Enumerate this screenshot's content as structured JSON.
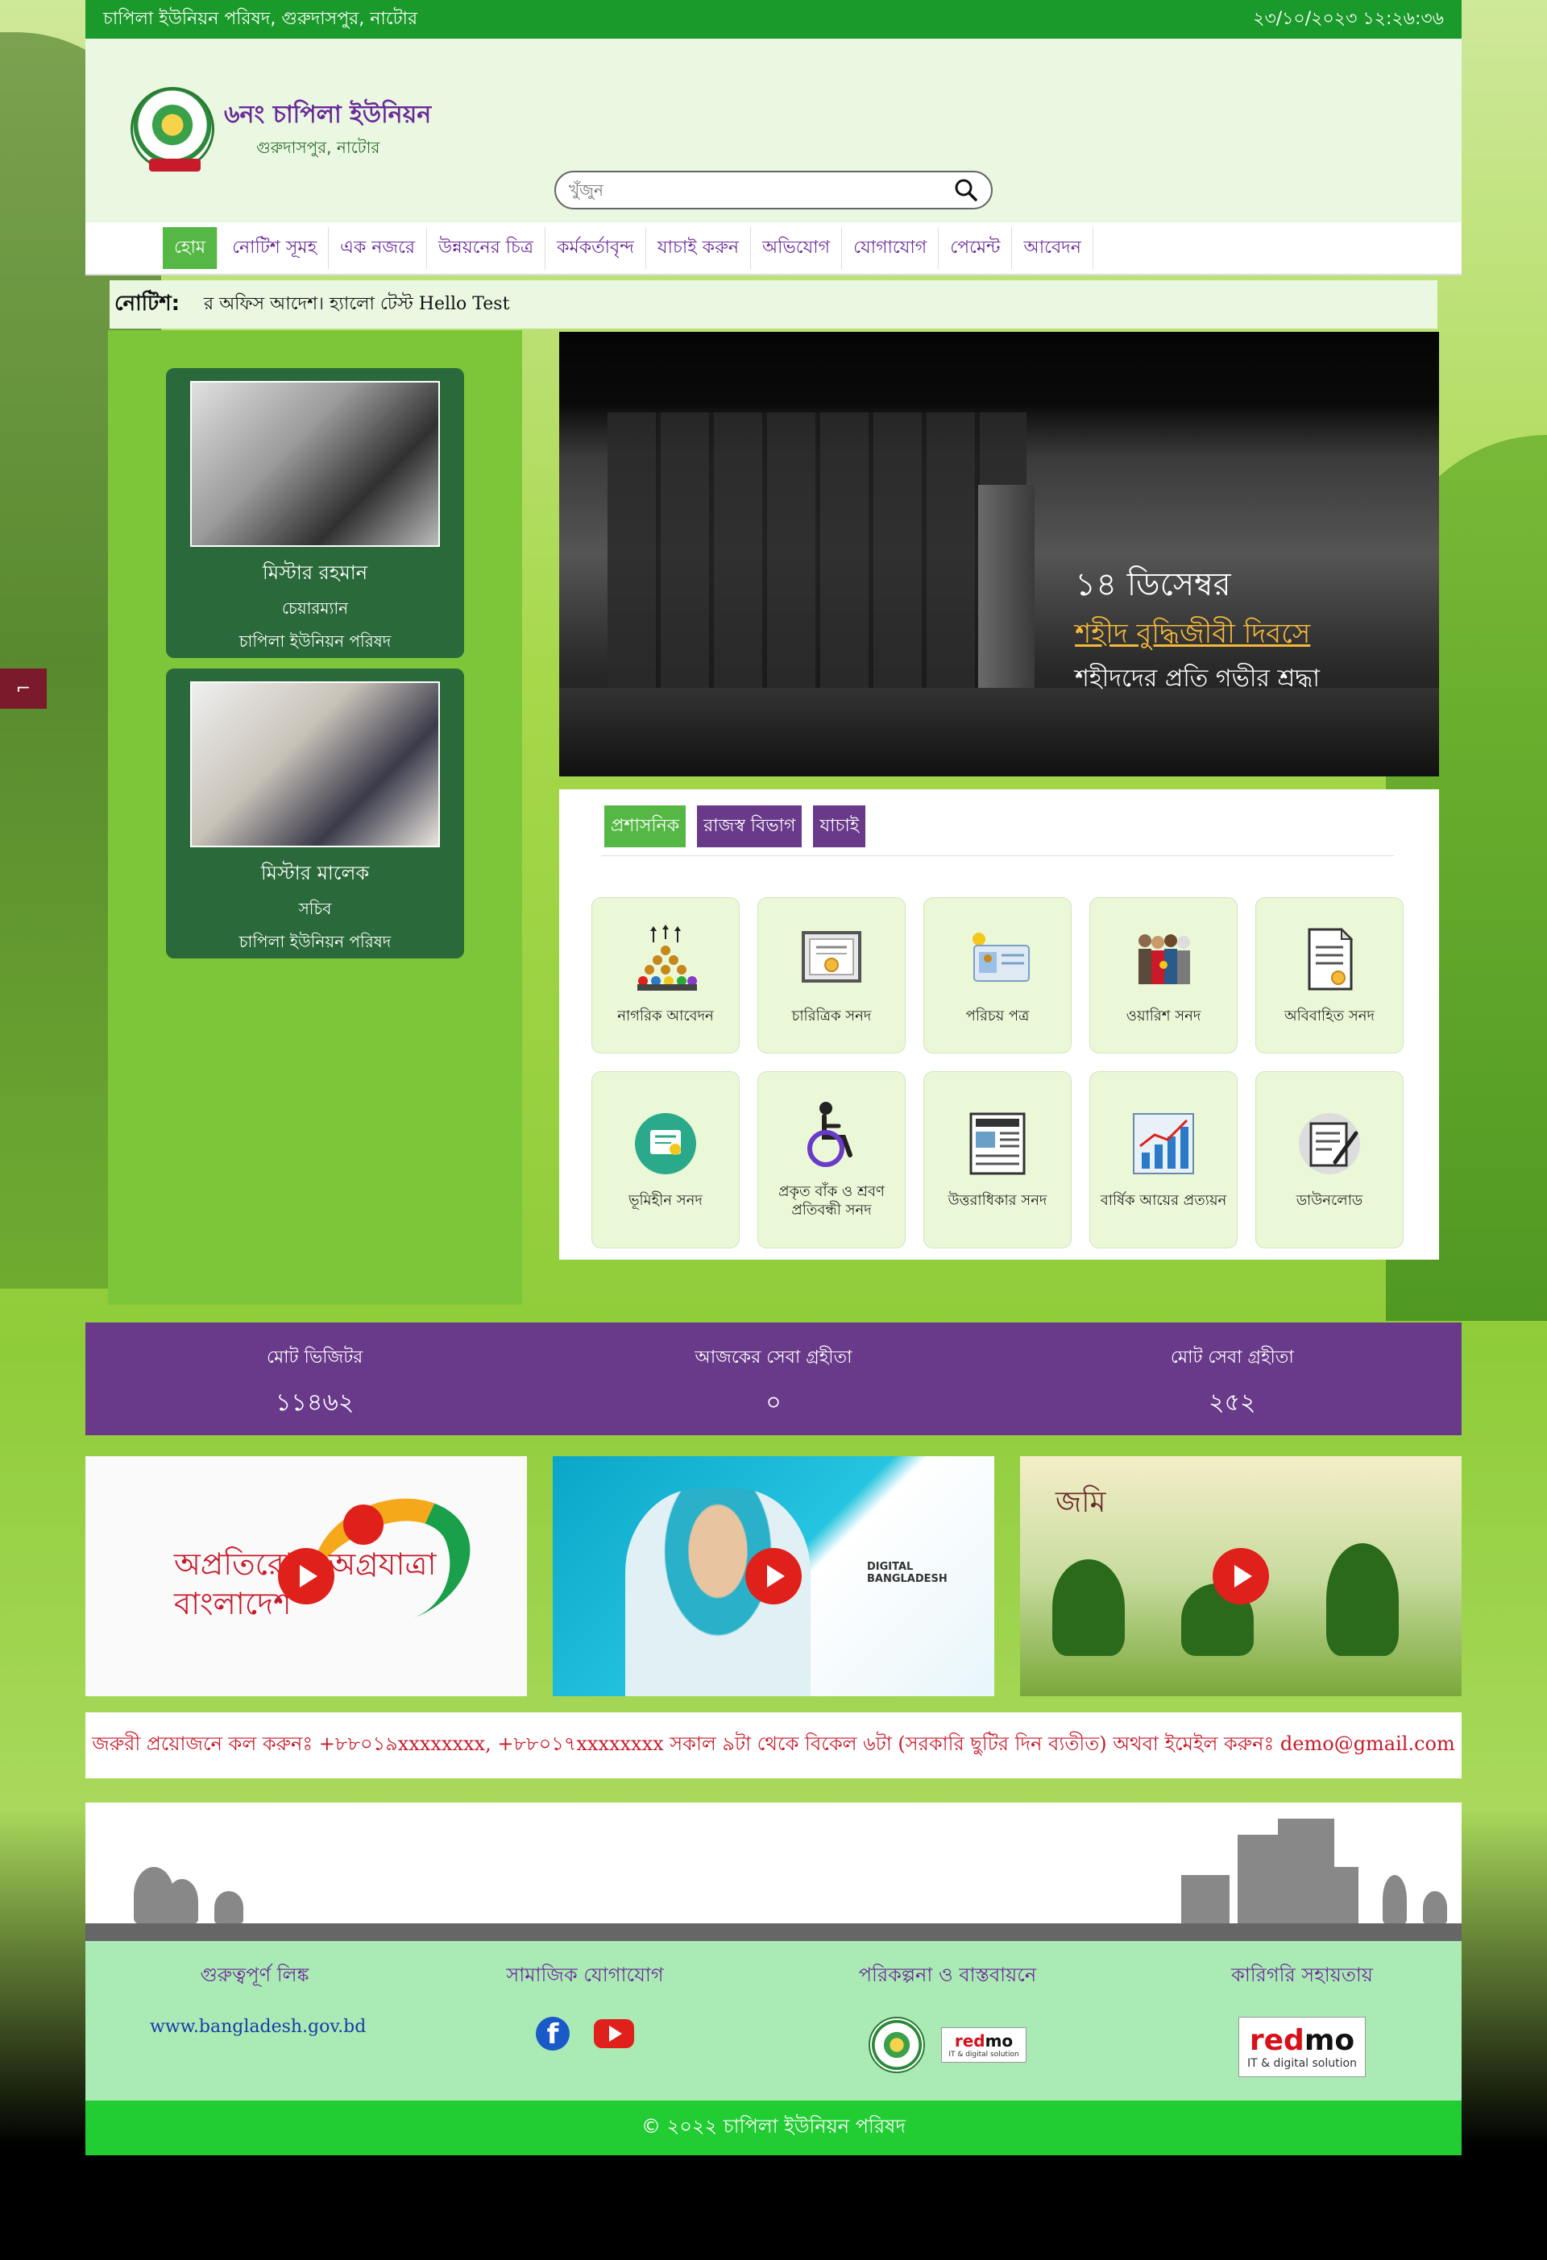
{
  "topbar": {
    "left_text": "চাপিলা ইউনিয়ন পরিষদ, গুরুদাসপুর, নাটোর",
    "datetime": "২৩/১০/২০২৩ ১২:২৬:৩৬"
  },
  "header": {
    "title": "৬নং চাপিলা ইউনিয়ন",
    "subtitle": "গুরুদাসপুর, নাটোর"
  },
  "search": {
    "placeholder": "খুঁজুন"
  },
  "nav": {
    "items": [
      "হোম",
      "নোটিশ সূমহ",
      "এক নজরে",
      "উন্নয়নের চিত্র",
      "কর্মকর্তাবৃন্দ",
      "যাচাই করুন",
      "অভিযোগ",
      "যোগাযোগ",
      "পেমেন্ট",
      "আবেদন"
    ]
  },
  "notice": {
    "label": "নোটিশ:",
    "text": "র অফিস আদেশ। হ্যালো টেস্ট Hello Test"
  },
  "officials": [
    {
      "name": "মিস্টার রহমান",
      "role": "চেয়ারম্যান",
      "org": "চাপিলা ইউনিয়ন পরিষদ"
    },
    {
      "name": "মিস্টার মালেক",
      "role": "সচিব",
      "org": "চাপিলা ইউনিয়ন পরিষদ"
    }
  ],
  "banner": {
    "line1": "১৪ ডিসেম্বর",
    "line2": "শহীদ বুদ্ধিজীবী দিবসে",
    "line3": "শহীদদের প্রতি গভীর শ্রদ্ধা"
  },
  "service_tabs": [
    "প্রশাসনিক",
    "রাজস্ব বিভাগ",
    "যাচাই"
  ],
  "services": [
    {
      "label": "নাগরিক আবেদন",
      "icon": "citizens-icon"
    },
    {
      "label": "চারিত্রিক সনদ",
      "icon": "certificate-icon"
    },
    {
      "label": "পরিচয় পত্র",
      "icon": "id-card-icon"
    },
    {
      "label": "ওয়ারিশ সনদ",
      "icon": "family-icon"
    },
    {
      "label": "অবিবাহিত সনদ",
      "icon": "document-seal-icon"
    },
    {
      "label": "ভূমিহীন সনদ",
      "icon": "award-icon"
    },
    {
      "label": "প্রকৃত বাঁক ও শ্রবণ প্রতিবন্ধী সনদ",
      "icon": "wheelchair-icon"
    },
    {
      "label": "উত্তরাধিকার সনদ",
      "icon": "newspaper-icon"
    },
    {
      "label": "বার্ষিক আয়ের প্রত্যয়ন",
      "icon": "bar-chart-icon"
    },
    {
      "label": "ডাউনলোড",
      "icon": "sign-document-icon"
    }
  ],
  "stats": [
    {
      "label": "মোট ভিজিটর",
      "value": "১১৪৬২"
    },
    {
      "label": "আজকের সেবা গ্রহীতা",
      "value": "০"
    },
    {
      "label": "মোট সেবা গ্রহীতা",
      "value": "২৫২"
    }
  ],
  "videos": {
    "v1_text": "অপ্রতিরোধ্য অগ্রযাত্রা বাংলাদেশ",
    "v2_text": "DIGITAL BANGLADESH",
    "v3_text": "জমি"
  },
  "contact": {
    "text": "জরুরী প্রয়োজনে কল করুনঃ +৮৮০১৯xxxxxxxx, +৮৮০১৭xxxxxxxx সকাল ৯টা থেকে বিকেল ৬টা (সরকারি ছুটির দিন ব্যতীত) অথবা ইমেইল করুনঃ demo@gmail.com"
  },
  "footer": {
    "col1_title": "গুরুত্বপূর্ণ লিঙ্ক",
    "col1_link": "www.bangladesh.gov.bd",
    "col2_title": "সামাজিক যোগাযোগ",
    "col3_title": "পরিকল্পনা ও বাস্তবায়নে",
    "col4_title": "কারিগরি সহায়তায়",
    "redmo_sub": "IT & digital solution",
    "copyright": "© ২০২২ চাপিলা ইউনিয়ন পরিষদ"
  },
  "colors": {
    "topbar": "#1a9a2a",
    "purple": "#6a3a8a",
    "green_accent": "#55b845",
    "footer_bg": "#aaeab4"
  }
}
